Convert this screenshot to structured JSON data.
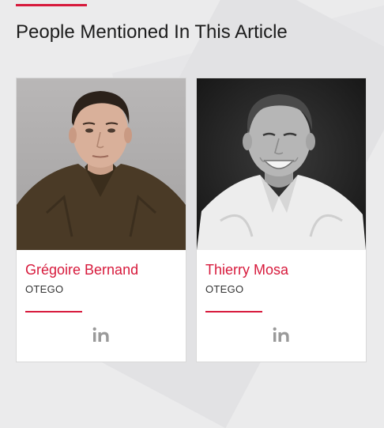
{
  "section": {
    "title": "People Mentioned In This Article"
  },
  "people": [
    {
      "name": "Grégoire Bernand",
      "company": "OTEGO",
      "photo_icon": "portrait-photo",
      "social_icon": "linkedin-icon"
    },
    {
      "name": "Thierry Mosa",
      "company": "OTEGO",
      "photo_icon": "portrait-photo",
      "social_icon": "linkedin-icon"
    }
  ],
  "colors": {
    "accent": "#d71a3c",
    "icon_gray": "#9a9a9a",
    "text_dark": "#1c1c1c"
  }
}
